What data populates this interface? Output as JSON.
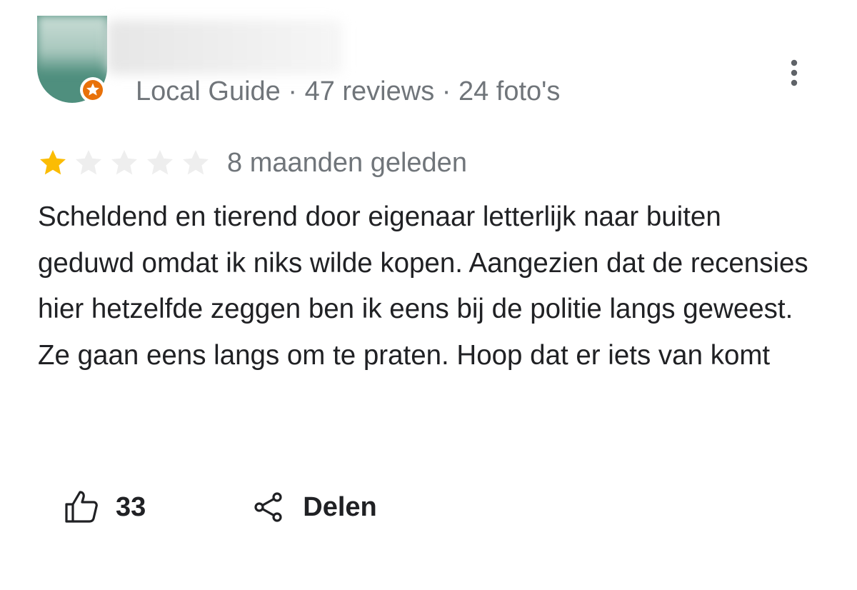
{
  "reviewer": {
    "name": "",
    "meta": "Local Guide · 47 reviews · 24 foto's",
    "badge_icon": "local-guide-star-badge",
    "badge_color": "#e8710a",
    "avatar_color": "#4f8f7e"
  },
  "menu": {
    "icon": "more-vert-icon"
  },
  "review": {
    "rating": 1,
    "max_rating": 5,
    "star_filled_color": "#fbbc04",
    "star_empty_color": "#eeeeee",
    "time_ago": "8 maanden geleden",
    "text": "Scheldend en tierend door eigenaar letterlijk naar buiten geduwd omdat ik niks wilde kopen. Aangezien dat de recensies hier hetzelfde zeggen ben ik eens bij de politie langs geweest. Ze gaan eens langs om te praten. Hoop dat er iets van komt"
  },
  "actions": {
    "like_count": "33",
    "like_icon": "thumb-up-icon",
    "share_label": "Delen",
    "share_icon": "share-icon"
  }
}
